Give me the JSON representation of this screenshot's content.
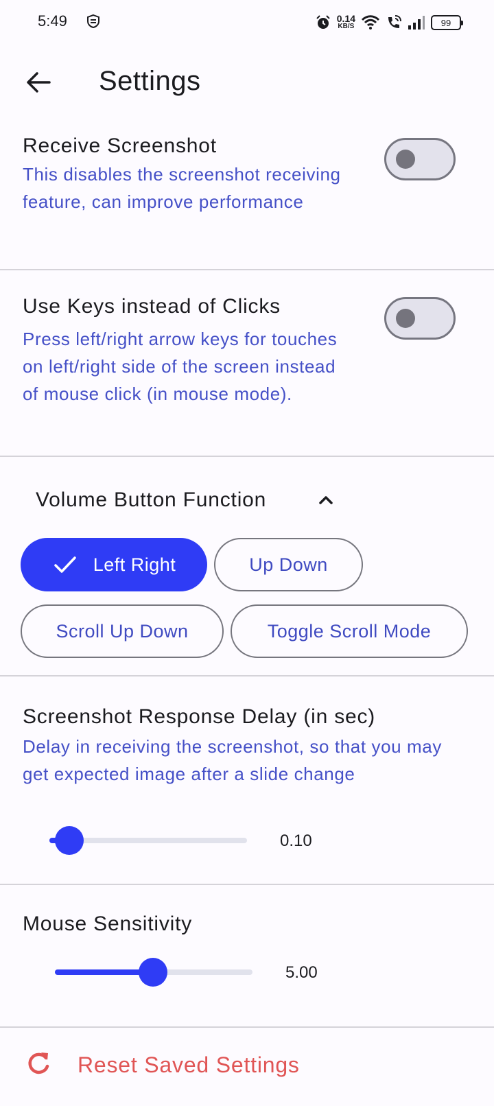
{
  "status_bar": {
    "time": "5:49",
    "speed_value": "0.14",
    "speed_unit": "KB/S",
    "battery": "99",
    "icons": [
      "app-shield-icon",
      "alarm-icon",
      "wifi-icon",
      "wifi-call-icon",
      "signal-icon",
      "battery-icon"
    ]
  },
  "app_bar": {
    "title": "Settings",
    "back_icon": "arrow-left-icon"
  },
  "receive_screenshot": {
    "title": "Receive Screenshot",
    "description": "This disables the screenshot receiving feature, can improve performance",
    "enabled": false
  },
  "use_keys": {
    "title": "Use Keys instead of Clicks",
    "description": "Press left/right arrow keys for touches on left/right side of the screen instead of mouse click (in mouse mode).",
    "enabled": false
  },
  "volume_button": {
    "header": "Volume Button Function",
    "expanded_icon": "chevron-up-icon",
    "options": [
      "Left Right",
      "Up Down",
      "Scroll Up Down",
      "Toggle Scroll Mode"
    ],
    "selected": "Left Right"
  },
  "screenshot_delay": {
    "title": "Screenshot Response Delay (in sec)",
    "description": "Delay in receiving the screenshot, so that you may get expected image after a slide change",
    "value_label": "0.10",
    "value": 0.1
  },
  "mouse_sensitivity": {
    "title": "Mouse Sensitivity",
    "value_label": "5.00",
    "value": 5.0
  },
  "reset": {
    "label": "Reset Saved Settings",
    "icon": "refresh-icon"
  },
  "colors": {
    "accent": "#2F3CF5",
    "description_text": "#4550C7",
    "danger": "#E05555",
    "background": "#FDFBFF"
  }
}
